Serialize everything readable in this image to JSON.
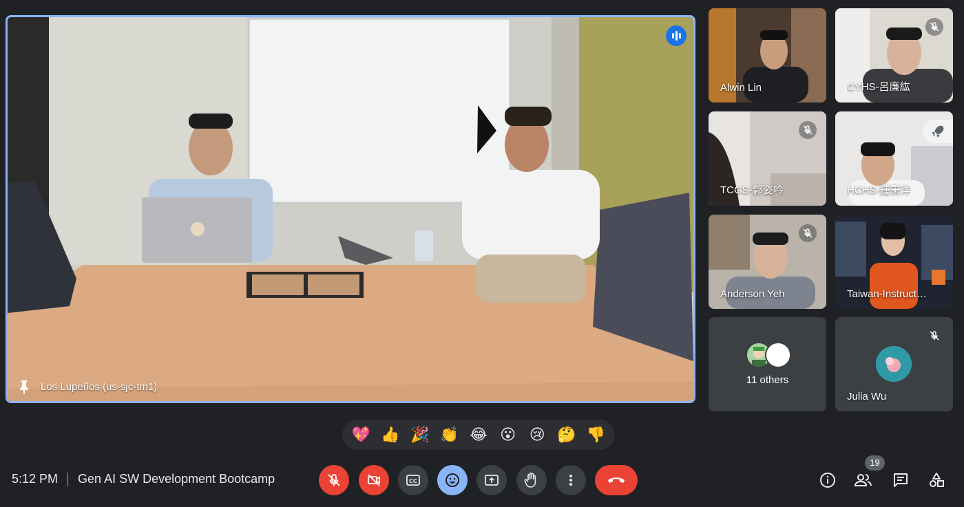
{
  "main": {
    "label": "Los Lupeños (us-sjc-tm1)"
  },
  "participants": [
    {
      "name": "Alwin Lin",
      "muted": false
    },
    {
      "name": "CYHS-呂廉紘",
      "muted": true
    },
    {
      "name": "TCGS-郭姿吟",
      "muted": true
    },
    {
      "name": "HCHS-鍾秉洋",
      "muted": false
    },
    {
      "name": "Anderson Yeh",
      "muted": true
    },
    {
      "name": "Taiwan-Instruct…",
      "muted": false
    },
    {
      "name": "11 others",
      "muted": false
    },
    {
      "name": "Julia Wu",
      "muted": true
    }
  ],
  "reactions": [
    "💖",
    "👍",
    "🎉",
    "👏",
    "😂",
    "😮",
    "😢",
    "🤔",
    "👎"
  ],
  "meeting": {
    "time": "5:12 PM",
    "title": "Gen AI SW Development Bootcamp"
  },
  "people_count": "19",
  "colors": {
    "background": "#202124",
    "active_border": "#8ab4f8",
    "danger": "#ea4335",
    "control_gray": "#3c4043",
    "accent_blue": "#1a73e8"
  }
}
